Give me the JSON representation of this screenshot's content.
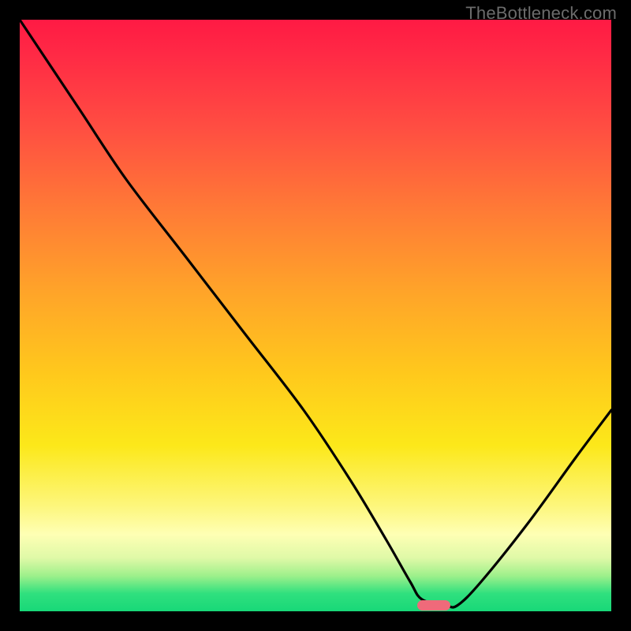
{
  "watermark": "TheBottleneck.com",
  "colors": {
    "frame_bg": "#000000",
    "curve_stroke": "#000000",
    "marker_fill": "#ef6a7a",
    "watermark_text": "#6c6c6c"
  },
  "chart_data": {
    "type": "line",
    "title": "",
    "xlabel": "",
    "ylabel": "",
    "xlim": [
      0,
      100
    ],
    "ylim": [
      0,
      100
    ],
    "grid": false,
    "legend": false,
    "series": [
      {
        "name": "bottleneck-curve",
        "x": [
          0,
          10,
          18,
          28,
          38,
          48,
          56,
          62,
          66,
          68,
          72,
          74,
          78,
          86,
          94,
          100
        ],
        "values": [
          100,
          85,
          73,
          60,
          47,
          34,
          22,
          12,
          5,
          2,
          1,
          1,
          5,
          15,
          26,
          34
        ]
      }
    ],
    "marker": {
      "x_center": 70,
      "y_center": 1,
      "width_pct": 5.5,
      "height_pct": 1.8
    }
  }
}
